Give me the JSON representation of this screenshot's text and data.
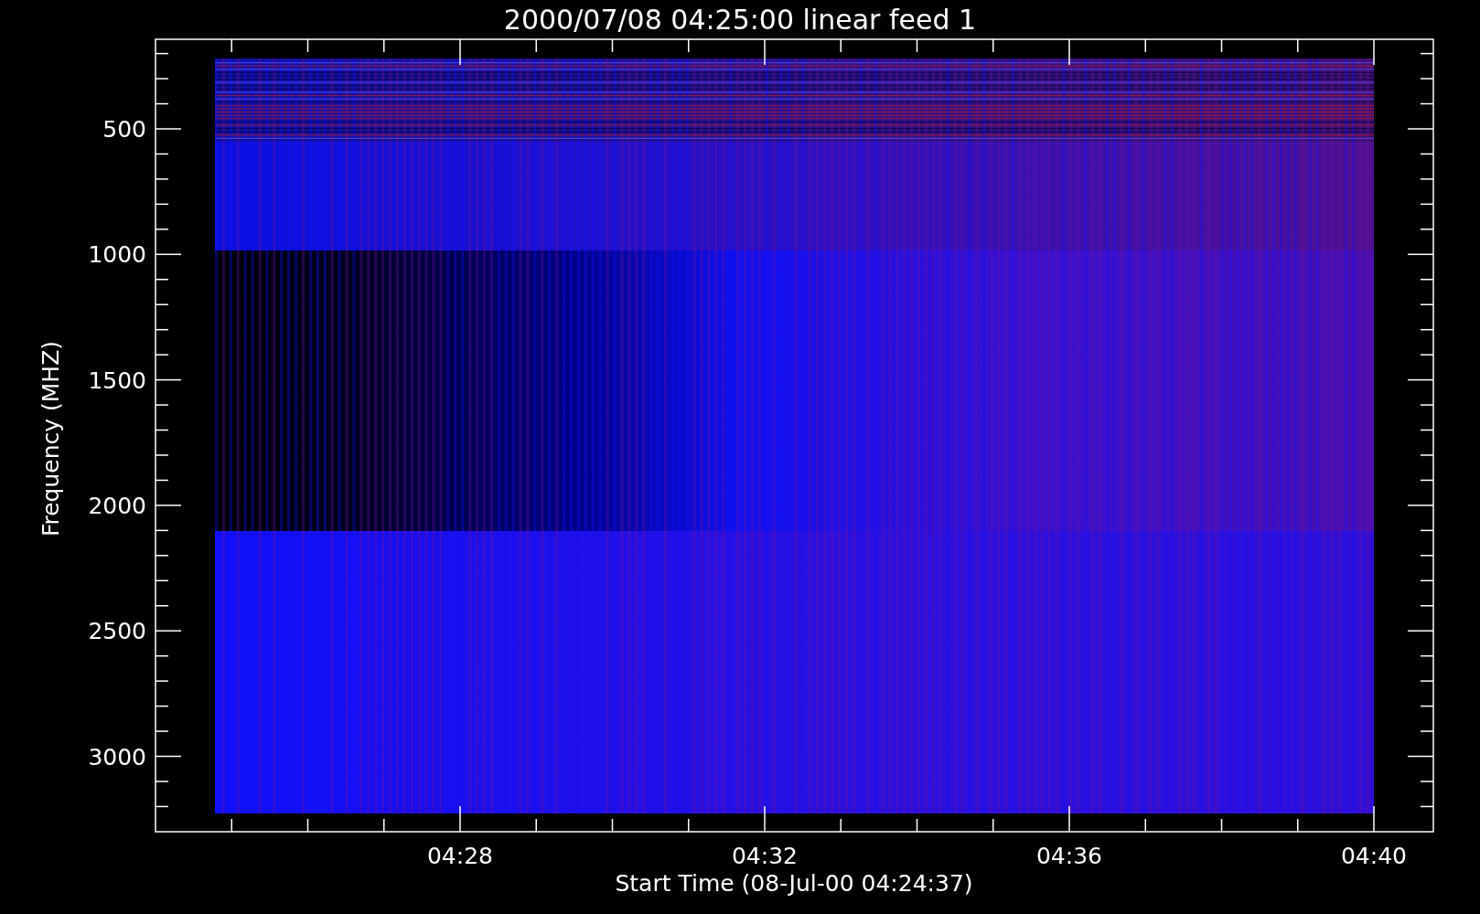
{
  "title": "2000/07/08 04:25:00 linear feed 1",
  "y_axis": {
    "label": "Frequency (MHZ)",
    "ticks": [
      "500",
      "1000",
      "1500",
      "2000",
      "2500",
      "3000"
    ]
  },
  "x_axis": {
    "label": "Start Time (08-Jul-00 04:24:37)",
    "ticks": [
      "04:28",
      "04:32",
      "04:36",
      "04:40"
    ]
  }
}
